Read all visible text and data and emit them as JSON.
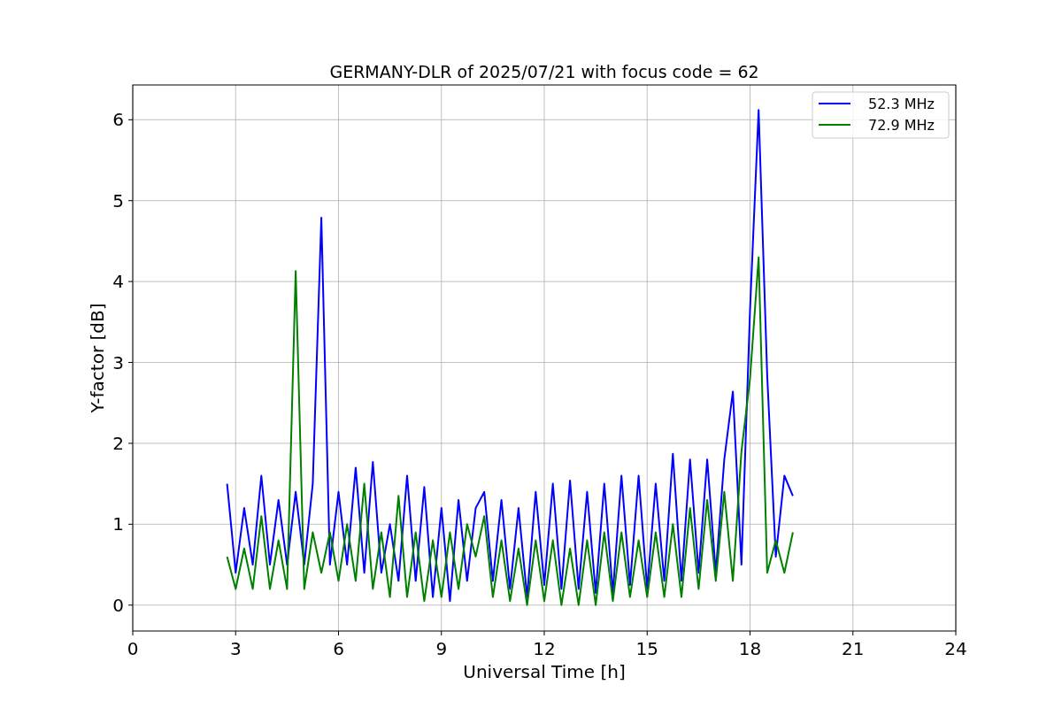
{
  "chart_data": {
    "type": "line",
    "title": "GERMANY-DLR of 2025/07/21 with focus code = 62",
    "xlabel": "Universal Time [h]",
    "ylabel": "Y-factor [dB]",
    "x": [
      2.75,
      3.0,
      3.25,
      3.5,
      3.75,
      4.0,
      4.25,
      4.5,
      4.75,
      5.0,
      5.25,
      5.5,
      5.75,
      6.0,
      6.25,
      6.5,
      6.75,
      7.0,
      7.25,
      7.5,
      7.75,
      8.0,
      8.25,
      8.5,
      8.75,
      9.0,
      9.25,
      9.5,
      9.75,
      10.0,
      10.25,
      10.5,
      10.75,
      11.0,
      11.25,
      11.5,
      11.75,
      12.0,
      12.25,
      12.5,
      12.75,
      13.0,
      13.25,
      13.5,
      13.75,
      14.0,
      14.25,
      14.5,
      14.75,
      15.0,
      15.25,
      15.5,
      15.75,
      16.0,
      16.25,
      16.5,
      16.75,
      17.0,
      17.25,
      17.5,
      17.75,
      18.0,
      18.25,
      18.5,
      18.75,
      19.0,
      19.25
    ],
    "series": [
      {
        "name": "52.3 MHz",
        "color": "#0000ff",
        "values": [
          1.5,
          0.4,
          1.2,
          0.5,
          1.6,
          0.5,
          1.3,
          0.5,
          1.4,
          0.5,
          1.5,
          4.79,
          0.5,
          1.4,
          0.5,
          1.7,
          0.4,
          1.77,
          0.4,
          1.0,
          0.3,
          1.6,
          0.3,
          1.46,
          0.1,
          1.2,
          0.05,
          1.3,
          0.3,
          1.2,
          1.4,
          0.3,
          1.3,
          0.2,
          1.2,
          0.1,
          1.4,
          0.25,
          1.5,
          0.2,
          1.54,
          0.2,
          1.4,
          0.15,
          1.5,
          0.15,
          1.6,
          0.25,
          1.6,
          0.2,
          1.5,
          0.3,
          1.87,
          0.3,
          1.8,
          0.4,
          1.8,
          0.4,
          1.8,
          2.64,
          0.5,
          3.65,
          6.12,
          2.84,
          0.6,
          1.6,
          1.35
        ]
      },
      {
        "name": "72.9 MHz",
        "color": "#008000",
        "values": [
          0.6,
          0.2,
          0.7,
          0.2,
          1.1,
          0.2,
          0.8,
          0.2,
          4.13,
          0.2,
          0.9,
          0.4,
          0.9,
          0.3,
          1.0,
          0.3,
          1.5,
          0.2,
          0.9,
          0.1,
          1.35,
          0.1,
          0.9,
          0.05,
          0.8,
          0.1,
          0.9,
          0.2,
          1.0,
          0.6,
          1.1,
          0.1,
          0.8,
          0.05,
          0.7,
          0.0,
          0.8,
          0.05,
          0.8,
          0.0,
          0.7,
          0.0,
          0.8,
          0.0,
          0.9,
          0.05,
          0.9,
          0.1,
          0.8,
          0.1,
          0.9,
          0.1,
          1.0,
          0.1,
          1.2,
          0.2,
          1.3,
          0.3,
          1.4,
          0.3,
          1.9,
          2.8,
          4.3,
          0.4,
          0.8,
          0.4,
          0.9
        ]
      }
    ],
    "xlim": [
      0,
      24
    ],
    "ylim": [
      -0.32,
      6.43
    ],
    "xticks": [
      0,
      3,
      6,
      9,
      12,
      15,
      18,
      21,
      24
    ],
    "yticks": [
      0,
      1,
      2,
      3,
      4,
      5,
      6
    ],
    "grid": true,
    "legend": true
  }
}
